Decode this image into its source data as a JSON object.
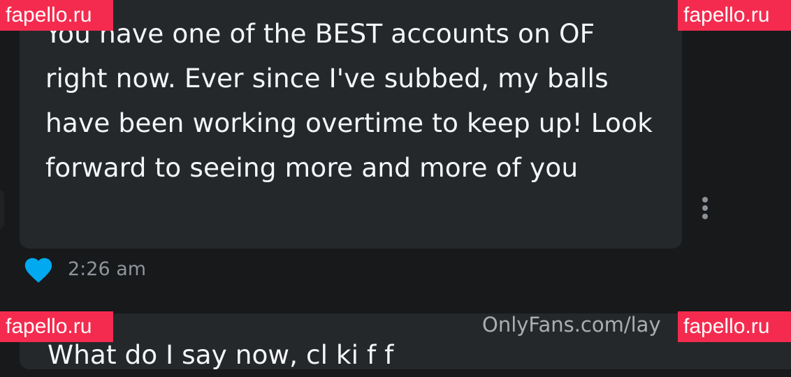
{
  "message": {
    "text": "You have one of the BEST accounts on OF right now. Ever since I've subbed, my balls have been working overtime to keep up! Look forward to seeing more and more of you",
    "time": "2:26 am",
    "liked": true
  },
  "next_message": {
    "partial_text": "What do I say now, cl ki     f     f"
  },
  "page_watermark": "OnlyFans.com/lay",
  "site_badge": {
    "label": "fapello.ru"
  },
  "colors": {
    "background": "#17191b",
    "bubble": "#25282b",
    "heart": "#00a9f0",
    "badge": "#f42b4f",
    "timestamp": "#8f959b"
  },
  "icons": {
    "like": "heart-icon",
    "menu": "more-vertical-icon"
  }
}
